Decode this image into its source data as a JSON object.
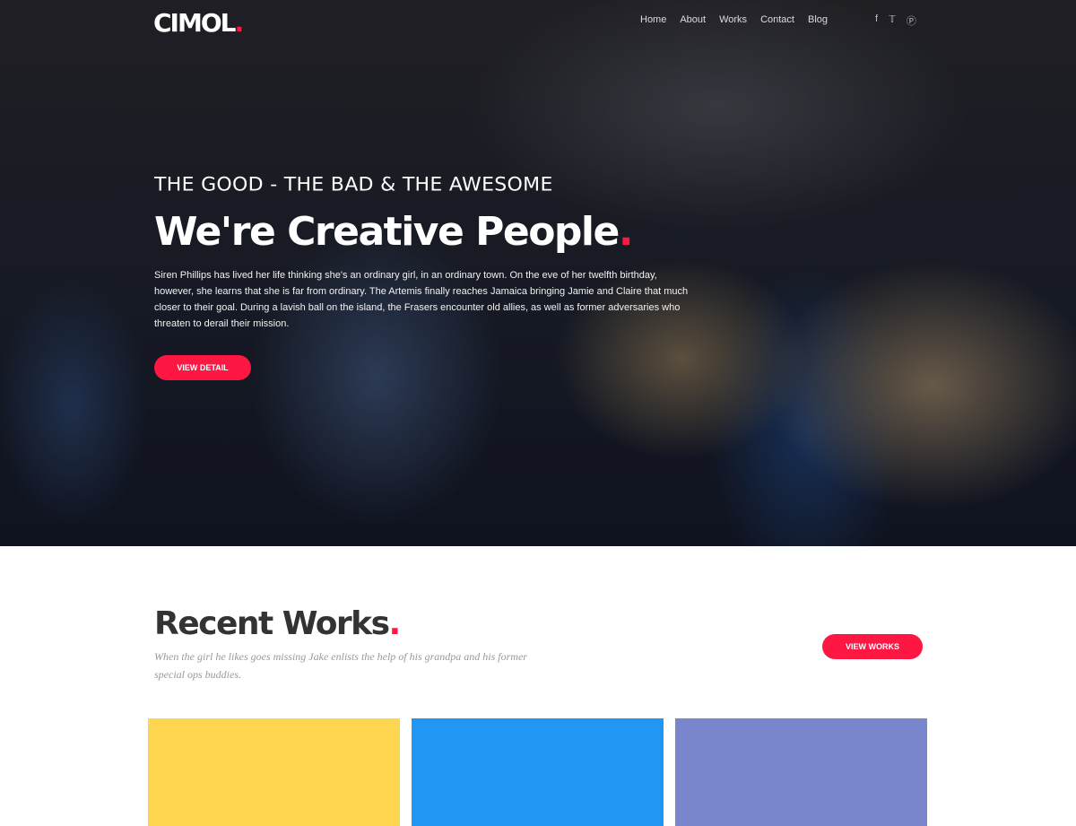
{
  "nav": {
    "logo": "CIMOL",
    "logo_dot": ".",
    "menu": [
      "Home",
      "About",
      "Works",
      "Contact",
      "Blog"
    ],
    "social": [
      "facebook-icon",
      "twitter-icon",
      "pinterest-icon"
    ]
  },
  "hero": {
    "kicker": "THE GOOD - THE BAD & THE AWESOME",
    "title": "We're Creative People",
    "title_dot": ".",
    "description": "Siren Phillips has lived her life thinking she's an ordinary girl, in an ordinary town. On the eve of her twelfth birthday, however, she learns that she is far from ordinary. The Artemis finally reaches Jamaica bringing Jamie and Claire that much closer to their goal. During a lavish ball on the island, the Frasers encounter old allies, as well as former adversaries who threaten to derail their mission.",
    "button": "VIEW DETAIL"
  },
  "recent": {
    "title": "Recent Works",
    "title_dot": ".",
    "subtitle": "When the girl he likes goes missing Jake enlists the help of his grandpa and his former special ops buddies.",
    "button": "VIEW WORKS",
    "cards": [
      {
        "color": "#fdd54f"
      },
      {
        "color": "#2196f3"
      },
      {
        "color": "#7986cb"
      }
    ]
  },
  "colors": {
    "accent": "#ff1744"
  }
}
